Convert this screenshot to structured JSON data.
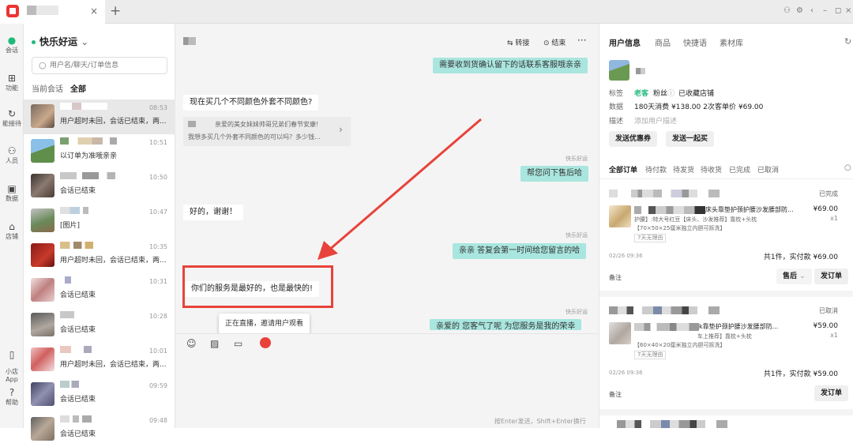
{
  "window": {
    "tab_close": "×",
    "add_tab": "+",
    "controls": [
      "⚇",
      "⚙",
      "‹",
      "–",
      "◻",
      "×"
    ]
  },
  "rail": [
    {
      "icon": "chat-icon",
      "glyph": "●",
      "label": "会话"
    },
    {
      "icon": "grid-icon",
      "glyph": "⊞",
      "label": "功能"
    },
    {
      "icon": "reception-icon",
      "glyph": "↻",
      "label": "能接待"
    },
    {
      "icon": "people-icon",
      "glyph": "⚇",
      "label": "人员"
    },
    {
      "icon": "data-icon",
      "glyph": "▣",
      "label": "数据"
    },
    {
      "icon": "store-icon",
      "glyph": "⌂",
      "label": "店铺"
    },
    {
      "icon": "phone-icon",
      "glyph": "▯",
      "label": "小店\nApp"
    },
    {
      "icon": "help-icon",
      "glyph": "?",
      "label": "帮助"
    }
  ],
  "conv_list": {
    "status": "快乐好运",
    "status_chevron": "⌄",
    "search_placeholder": "用户名/聊天/订单信息",
    "filter_current": "当前会话",
    "filter_all": "全部",
    "items": [
      {
        "time": "08:53",
        "msg": "用户超时未回，会话已结束，两..."
      },
      {
        "time": "10:51",
        "msg": "以订单为准哦亲亲"
      },
      {
        "time": "10:50",
        "msg": "会话已结束"
      },
      {
        "time": "10:47",
        "msg": "[图片]"
      },
      {
        "time": "10:35",
        "msg": "用户超时未回，会话已结束，两..."
      },
      {
        "time": "10:31",
        "msg": "会话已结束"
      },
      {
        "time": "10:28",
        "msg": "会话已结束"
      },
      {
        "time": "10:01",
        "msg": "用户超时未回，会话已结束，两..."
      },
      {
        "time": "09:59",
        "msg": "会话已结束"
      },
      {
        "time": "09:48",
        "msg": "会话已结束"
      }
    ]
  },
  "chat": {
    "transfer_label": "转接",
    "finish_label": "结束",
    "more": "···",
    "sender_tag": "快乐好运",
    "messages": [
      {
        "dir": "out",
        "text": "需要收到货确认留下的话联系客服哦亲亲"
      },
      {
        "dir": "in",
        "text": "现在买几个不同颜色外套不同颜色?"
      },
      {
        "dir": "out",
        "text": "帮您问下售后哈"
      },
      {
        "dir": "in",
        "text": "好的，谢谢！"
      },
      {
        "dir": "out",
        "text": "亲亲  答复会第一时间给您留言的哈"
      },
      {
        "dir": "in",
        "text": "你们的服务是最好的，也是最快的!"
      },
      {
        "dir": "out",
        "text": "亲爱的 您客气了呢  为您服务是我的荣幸"
      }
    ],
    "product_card_line1": "亲爱的美女妹妹帅哥兄弟们春节安康!",
    "product_card_line2": "我想多买几个外套不同颜色的可以吗？多少钱...",
    "live_tooltip": "正在直播，邀请用户观看",
    "send_hint": "按Enter发送，Shift+Enter换行"
  },
  "right": {
    "tabs": [
      "用户信息",
      "商品",
      "快捷语",
      "素材库"
    ],
    "labels": {
      "tag": "标签",
      "data": "数据",
      "desc": "描述"
    },
    "tag_old_customer": "老客",
    "tag_fans": "粉丝",
    "tag_fans_icon": "ⓘ",
    "tag_collected": "已收藏店铺",
    "data_text": "180天消费 ¥138.00  2次",
    "unit_price": "客单价 ¥69.00",
    "desc_placeholder": "添加用户描述",
    "btn_coupon": "发送优惠券",
    "btn_together": "发送一起买",
    "order_tabs": [
      "全部订单",
      "待付款",
      "待发货",
      "待收货",
      "已完成",
      "已取消"
    ],
    "orders": [
      {
        "status": "已完成",
        "title": "床头靠垫护颈护腰沙发腰部防...",
        "price": "¥69.00",
        "qty": "x1",
        "spec": "护腰】:特大号红豆【床头、沙发推荐】靠枕+头枕",
        "size": "【70×50×25厘米独立内胆可拆洗】",
        "tag": "7天无理由",
        "date": "02/26 09:36",
        "summary": "共1件，实付款 ¥69.00",
        "note": "备注",
        "btn1": "售后",
        "btn1_chevron": "⌄",
        "btn2": "发订单"
      },
      {
        "status": "已取消",
        "title": "k靠垫护颈护腰沙发腰部防...",
        "price": "¥59.00",
        "qty": "x1",
        "spec": "车上推荐】靠枕+头枕",
        "size": "【60×40×20厘米独立内胆可拆洗】",
        "tag": "7天无理由",
        "date": "02/26 09:36",
        "summary": "共1件，实付款 ¥59.00",
        "note": "备注",
        "btn2": "发订单"
      }
    ]
  },
  "colors": {
    "accent_green": "#1fb97a",
    "bubble_out": "#a9e6df",
    "highlight_red": "#e8433a"
  }
}
